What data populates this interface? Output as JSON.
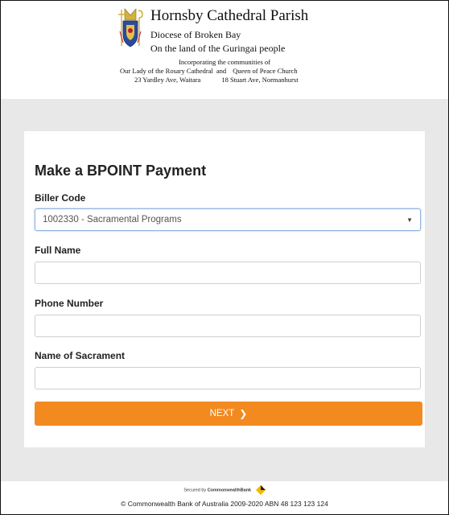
{
  "header": {
    "parish_name": "Hornsby Cathedral Parish",
    "diocese": "Diocese of Broken Bay",
    "land": "On the land of the Guringai people",
    "incorporating": "Incorporating the communities of",
    "church_1": "Our Lady of the Rosary Cathedral",
    "and_text": "and",
    "church_2": "Queen of Peace Church",
    "address_1": "23 Yardley Ave, Waitara",
    "address_2": "18 Stuart Ave, Normanhurst"
  },
  "form": {
    "title": "Make a BPOINT Payment",
    "biller_code_label": "Biller Code",
    "biller_code_value": "1002330 - Sacramental Programs",
    "full_name_label": "Full Name",
    "full_name_value": "",
    "phone_label": "Phone Number",
    "phone_value": "",
    "sacrament_label": "Name of Sacrament",
    "sacrament_value": "",
    "next_label": "NEXT",
    "next_chevron": "❯"
  },
  "footer": {
    "secured_by": "Secured by",
    "secured_brand": "CommonwealthBank",
    "copyright": "© Commonwealth Bank of Australia 2009-2020 ABN 48 123 123 124"
  },
  "colors": {
    "accent": "#f28a20",
    "band": "#e8e8e8",
    "cba_yellow": "#f5b800"
  },
  "icons": {
    "crest": "parish-crest-icon",
    "caret": "chevron-down-icon",
    "cba": "cba-diamond-icon"
  }
}
